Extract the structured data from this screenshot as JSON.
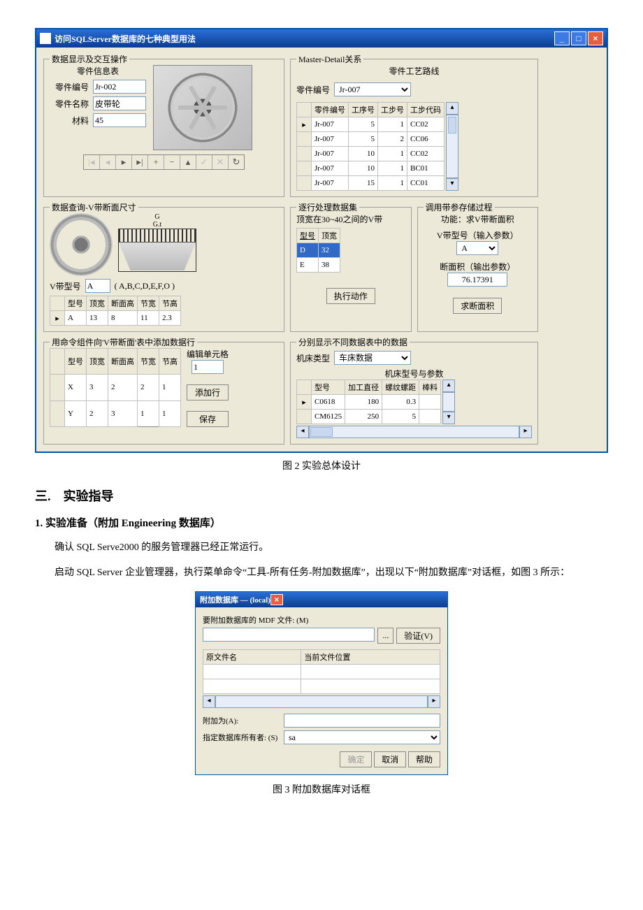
{
  "window": {
    "title": "访问SQLServer数据库的七种典型用法"
  },
  "g1": {
    "legend": "数据显示及交互操作",
    "sub": "零件信息表",
    "f1": {
      "l": "零件编号",
      "v": "Jr-002"
    },
    "f2": {
      "l": "零件名称",
      "v": "皮带轮"
    },
    "f3": {
      "l": "材料",
      "v": "45"
    }
  },
  "g2": {
    "legend": "Master-Detail关系",
    "sub": "零件工艺路线",
    "f1": {
      "l": "零件编号",
      "v": "Jr-007"
    },
    "cols": [
      "零件编号",
      "工序号",
      "工步号",
      "工步代码"
    ],
    "rows": [
      {
        "c": [
          "Jr-007",
          "5",
          "1",
          "CC02"
        ],
        "cur": true
      },
      {
        "c": [
          "Jr-007",
          "5",
          "2",
          "CC06"
        ]
      },
      {
        "c": [
          "Jr-007",
          "10",
          "1",
          "CC02"
        ]
      },
      {
        "c": [
          "Jr-007",
          "10",
          "1",
          "BC01"
        ]
      },
      {
        "c": [
          "Jr-007",
          "15",
          "1",
          "CC01"
        ]
      }
    ]
  },
  "g3": {
    "legend": "数据查询-V带断面尺寸",
    "f1": {
      "l": "V带型号",
      "v": "A",
      "hint": "( A,B,C,D,E,F,O )"
    },
    "cols": [
      "型号",
      "顶宽",
      "断面高",
      "节宽",
      "节高"
    ],
    "rows": [
      {
        "c": [
          "A",
          "13",
          "8",
          "11",
          "2.3"
        ],
        "cur": true
      }
    ]
  },
  "g4": {
    "legend": "逐行处理数据集",
    "sub": "顶宽在30~40之间的V带",
    "cols": [
      "型号",
      "顶宽"
    ],
    "rows": [
      {
        "c": [
          "D",
          "32"
        ],
        "sel": true
      },
      {
        "c": [
          "E",
          "38"
        ]
      }
    ],
    "btn": "执行动作"
  },
  "g5": {
    "legend": "调用带参存储过程",
    "sub": "功能：求V带断面积",
    "l1": "V带型号（输入参数）",
    "v1": "A",
    "l2": "断面积（输出参数）",
    "v2": "76.17391",
    "btn": "求断面积"
  },
  "g6": {
    "legend": "用命令组件向'V带断面'表中添加数据行",
    "cols": [
      "型号",
      "顶宽",
      "断面高",
      "节宽",
      "节高"
    ],
    "rows": [
      {
        "c": [
          "X",
          "3",
          "2",
          "2",
          "1"
        ]
      },
      {
        "c": [
          "Y",
          "2",
          "3",
          "1",
          "1"
        ]
      }
    ],
    "l": "编辑单元格",
    "v": "1",
    "b1": "添加行",
    "b2": "保存"
  },
  "g7": {
    "legend": "分别显示不同数据表中的数据",
    "f1": {
      "l": "机床类型",
      "v": "车床数据"
    },
    "sub": "机床型号与参数",
    "cols": [
      "型号",
      "加工直径",
      "螺纹螺距",
      "棒料"
    ],
    "rows": [
      {
        "c": [
          "C0618",
          "180",
          "0.3",
          ""
        ],
        "cur": true
      },
      {
        "c": [
          "CM6125",
          "250",
          "5",
          ""
        ]
      }
    ]
  },
  "fig2": "图 2  实验总体设计",
  "h2": "三.　实验指导",
  "h3": "1. 实验准备（附加 Engineering 数据库）",
  "p1": "确认 SQL Serve2000 的服务管理器已经正常运行。",
  "p2": "启动 SQL Server 企业管理器，执行菜单命令“工具-所有任务-附加数据库”，出现以下“附加数据库”对话框，如图 3 所示：",
  "dlg": {
    "title": "附加数据库 —  (local)",
    "l1": "要附加数据库的 MDF 文件: (M)",
    "browse": "...",
    "verify": "验证(V)",
    "c1": "原文件名",
    "c2": "当前文件位置",
    "l2": "附加为(A):",
    "v2": "",
    "l3": "指定数据库所有者: (S)",
    "v3": "sa",
    "ok": "确定",
    "cancel": "取消",
    "help": "帮助"
  },
  "fig3": "图 3  附加数据库对话框"
}
